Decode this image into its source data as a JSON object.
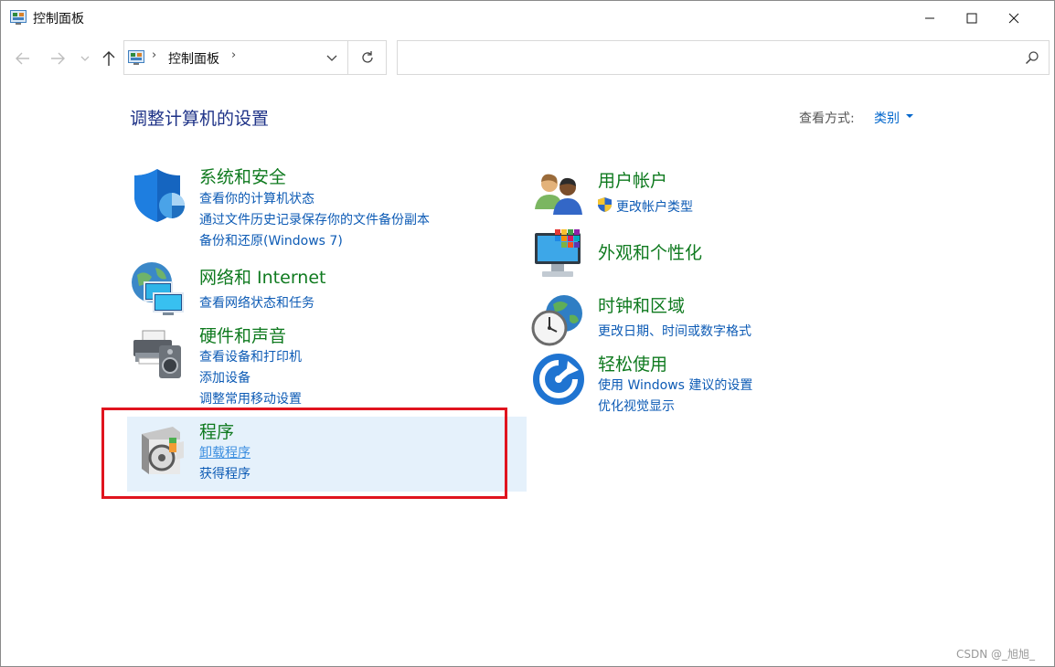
{
  "window": {
    "title": "控制面板",
    "title_icon": "control-panel-icon",
    "controls": [
      "minimize-icon",
      "maximize-icon",
      "close-icon"
    ]
  },
  "nav": {
    "back_icon": "back-arrow-icon",
    "forward_icon": "forward-arrow-icon",
    "recent_icon": "chevron-down-icon",
    "up_icon": "up-arrow-icon",
    "address": {
      "separator": "›",
      "crumb": "控制面板",
      "separator_after": "›"
    },
    "refresh_icon": "refresh-icon",
    "search": {
      "placeholder": "",
      "icon": "search-icon"
    }
  },
  "content": {
    "heading": "调整计算机的设置",
    "view_by_label": "查看方式:",
    "view_by_value": "类别",
    "left_categories": [
      {
        "title": "系统和安全",
        "icon": "shield-icon",
        "links": [
          "查看你的计算机状态",
          "通过文件历史记录保存你的文件备份副本",
          "备份和还原(Windows 7)"
        ]
      },
      {
        "title": "网络和 Internet",
        "icon": "network-globe-icon",
        "links": [
          "查看网络状态和任务"
        ]
      },
      {
        "title": "硬件和声音",
        "icon": "printer-speaker-icon",
        "links": [
          "查看设备和打印机",
          "添加设备",
          "调整常用移动设置"
        ]
      },
      {
        "title": "程序",
        "icon": "programs-disc-icon",
        "links": [
          "卸载程序",
          "获得程序"
        ]
      }
    ],
    "right_categories": [
      {
        "title": "用户帐户",
        "icon": "users-icon",
        "links": [
          "更改帐户类型"
        ],
        "link_icon": "uac-shield-icon"
      },
      {
        "title": "外观和个性化",
        "icon": "monitor-palette-icon",
        "links": []
      },
      {
        "title": "时钟和区域",
        "icon": "clock-globe-icon",
        "links": [
          "更改日期、时间或数字格式"
        ]
      },
      {
        "title": "轻松使用",
        "icon": "ease-of-access-icon",
        "links": [
          "使用 Windows 建议的设置",
          "优化视觉显示"
        ]
      }
    ]
  },
  "watermark": "CSDN @_旭旭_",
  "colors": {
    "category_title": "#0f7a1f",
    "link": "#0d5bb5",
    "heading": "#1e3287",
    "highlight_bg": "#e5f1fb",
    "annotation_border": "#e0141e"
  }
}
